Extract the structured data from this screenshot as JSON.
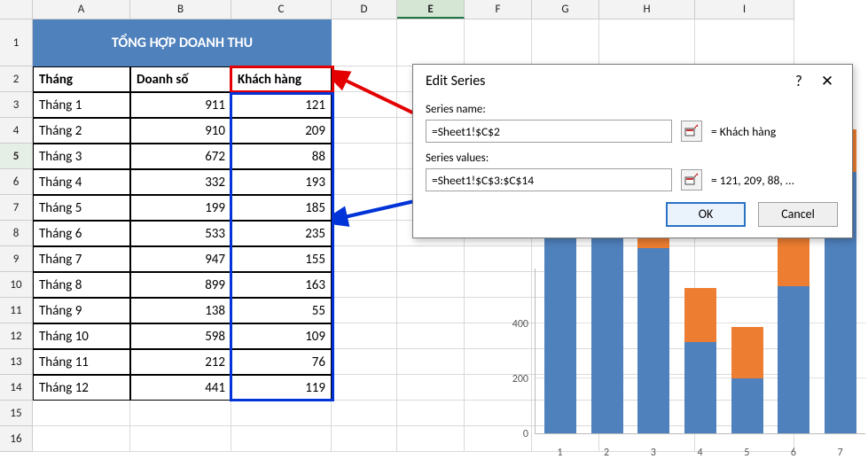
{
  "columns": [
    "A",
    "B",
    "C",
    "D",
    "E",
    "F",
    "G",
    "H",
    "I"
  ],
  "rows": [
    "1",
    "2",
    "3",
    "4",
    "5",
    "6",
    "7",
    "8",
    "9",
    "10",
    "11",
    "12",
    "13",
    "14",
    "15",
    "16"
  ],
  "active_column": "E",
  "active_row": "5",
  "title": "TỔNG HỢP DOANH THU",
  "headers": {
    "a": "Tháng",
    "b": "Doanh số",
    "c": "Khách hàng"
  },
  "data": [
    {
      "thang": "Tháng 1",
      "doanhso": "911",
      "kh": "121"
    },
    {
      "thang": "Tháng 2",
      "doanhso": "910",
      "kh": "209"
    },
    {
      "thang": "Tháng 3",
      "doanhso": "672",
      "kh": "88"
    },
    {
      "thang": "Tháng 4",
      "doanhso": "332",
      "kh": "193"
    },
    {
      "thang": "Tháng 5",
      "doanhso": "199",
      "kh": "185"
    },
    {
      "thang": "Tháng 6",
      "doanhso": "533",
      "kh": "235"
    },
    {
      "thang": "Tháng 7",
      "doanhso": "947",
      "kh": "155"
    },
    {
      "thang": "Tháng 8",
      "doanhso": "899",
      "kh": "163"
    },
    {
      "thang": "Tháng 9",
      "doanhso": "138",
      "kh": "55"
    },
    {
      "thang": "Tháng 10",
      "doanhso": "598",
      "kh": "109"
    },
    {
      "thang": "Tháng 11",
      "doanhso": "212",
      "kh": "76"
    },
    {
      "thang": "Tháng 12",
      "doanhso": "441",
      "kh": "119"
    }
  ],
  "dialog": {
    "title": "Edit Series",
    "help_icon": "?",
    "close_icon": "✕",
    "name_label": "Series name:",
    "name_value": "=Sheet1!$C$2",
    "name_preview": "= Khách hàng",
    "values_label": "Series values:",
    "values_value": "=Sheet1!$C$3:$C$14",
    "values_preview": "= 121, 209, 88, ...",
    "ok": "OK",
    "cancel": "Cancel"
  },
  "chart_data": {
    "type": "bar",
    "stacked": true,
    "categories": [
      "1",
      "2",
      "3",
      "4",
      "5",
      "6",
      "7"
    ],
    "series": [
      {
        "name": "Doanh số",
        "color": "#4F81BD",
        "values": [
          911,
          910,
          672,
          332,
          199,
          533,
          947
        ]
      },
      {
        "name": "Khách hàng",
        "color": "#ED7D31",
        "values": [
          121,
          209,
          88,
          193,
          185,
          235,
          155
        ]
      }
    ],
    "yticks": [
      "0",
      "200",
      "400"
    ],
    "ylim": [
      0,
      600
    ],
    "xlabel": "",
    "ylabel": "",
    "title": ""
  },
  "colors": {
    "red": "#E40000",
    "blue": "#0033D8",
    "brand_blue": "#4F81BD",
    "orange": "#ED7D31"
  }
}
